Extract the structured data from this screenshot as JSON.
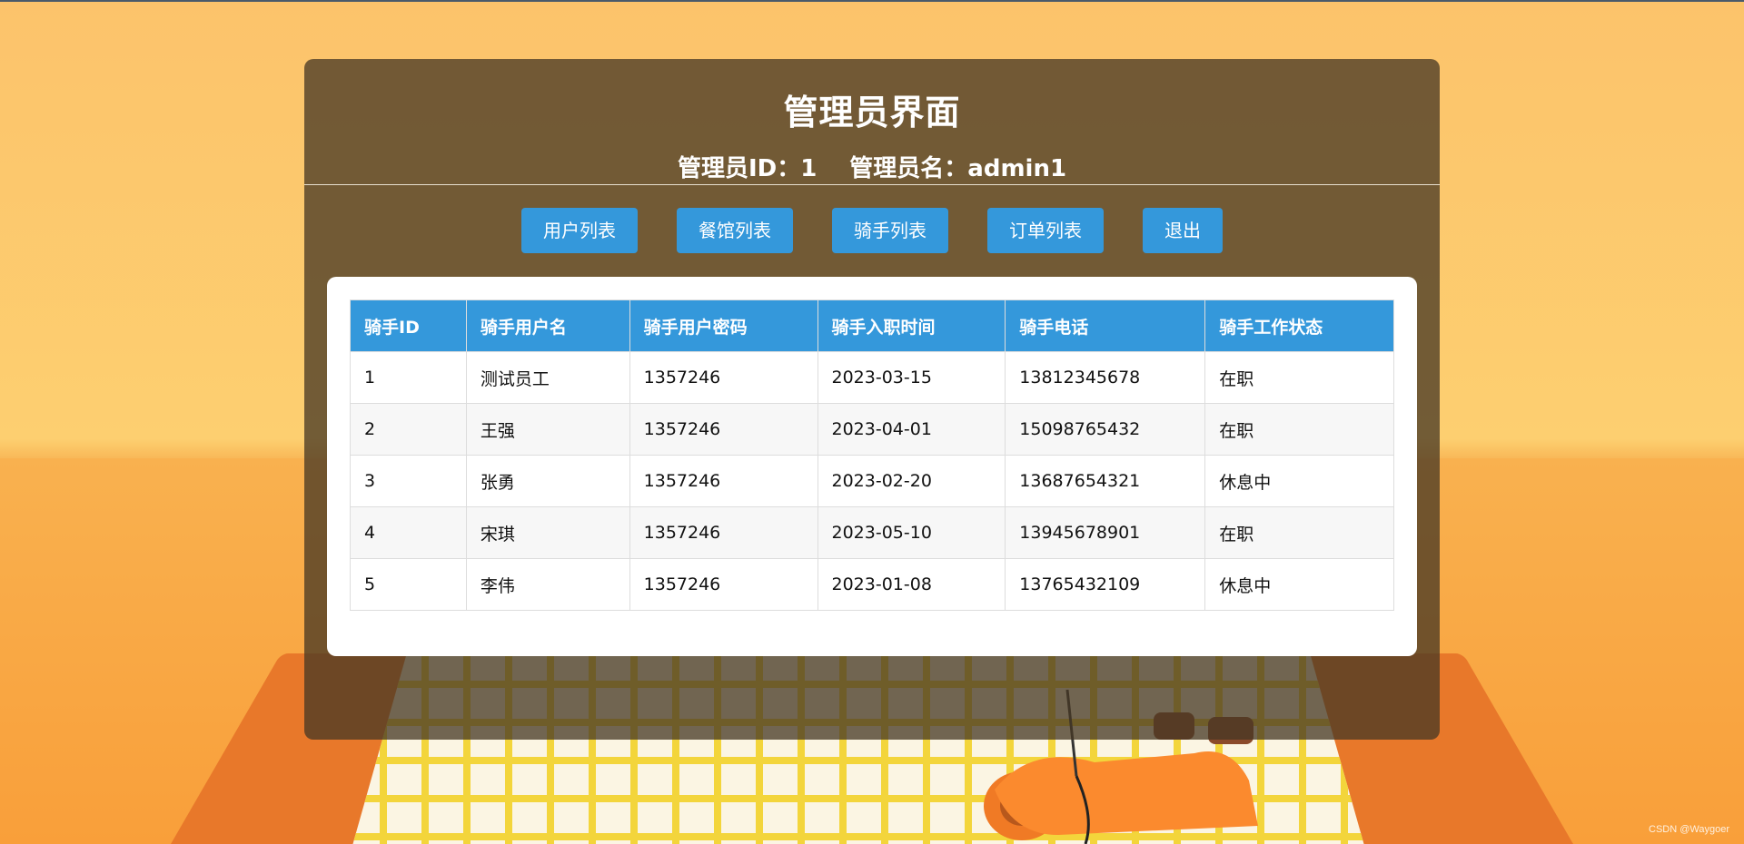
{
  "header": {
    "title": "管理员界面",
    "admin_id_label": "管理员ID：1",
    "admin_name_label": "管理员名：admin1"
  },
  "nav": {
    "items": [
      {
        "label": "用户列表"
      },
      {
        "label": "餐馆列表"
      },
      {
        "label": "骑手列表"
      },
      {
        "label": "订单列表"
      },
      {
        "label": "退出"
      }
    ]
  },
  "table": {
    "headers": [
      "骑手ID",
      "骑手用户名",
      "骑手用户密码",
      "骑手入职时间",
      "骑手电话",
      "骑手工作状态"
    ],
    "rows": [
      [
        "1",
        "测试员工",
        "1357246",
        "2023-03-15",
        "13812345678",
        "在职"
      ],
      [
        "2",
        "王强",
        "1357246",
        "2023-04-01",
        "15098765432",
        "在职"
      ],
      [
        "3",
        "张勇",
        "1357246",
        "2023-02-20",
        "13687654321",
        "休息中"
      ],
      [
        "4",
        "宋琪",
        "1357246",
        "2023-05-10",
        "13945678901",
        "在职"
      ],
      [
        "5",
        "李伟",
        "1357246",
        "2023-01-08",
        "13765432109",
        "休息中"
      ]
    ]
  },
  "watermark": "CSDN @Waygoer",
  "colors": {
    "accent": "#3498db",
    "panel": "#463723",
    "background": "#fcc36b"
  }
}
